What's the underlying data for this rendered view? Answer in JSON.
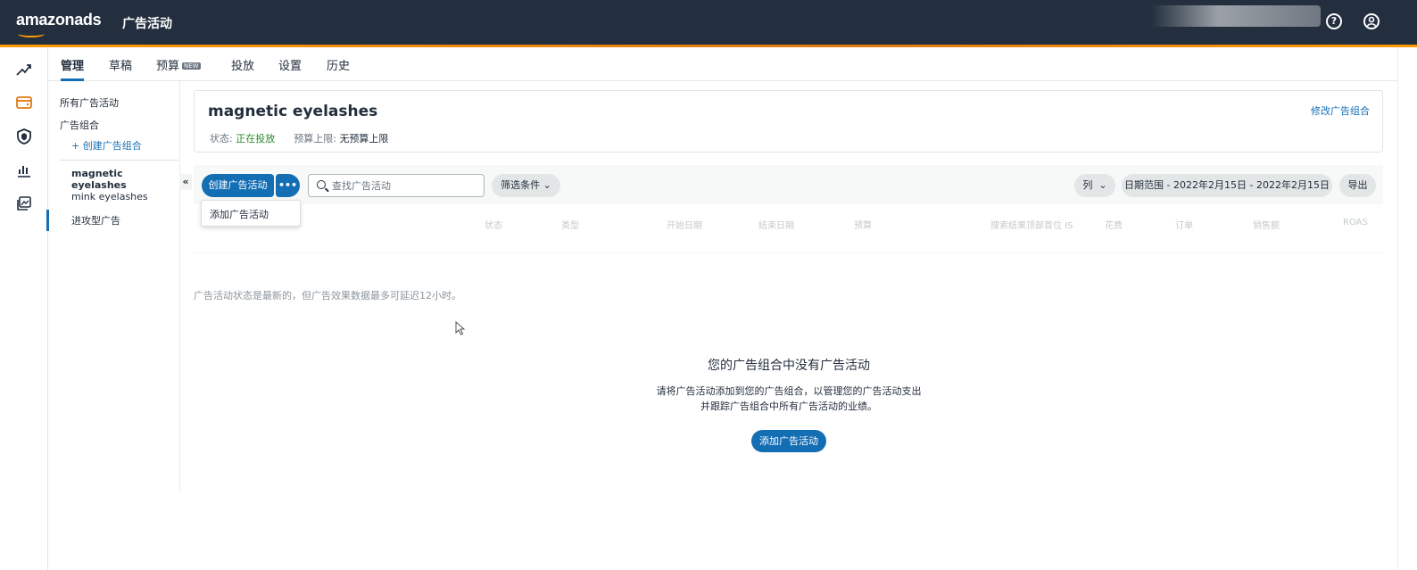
{
  "header": {
    "brand": "amazonads",
    "app_title": "广告活动",
    "help_icon": "question-circle-icon",
    "account_icon": "user-circle-icon"
  },
  "rail": {
    "icons": [
      "trend-chart-icon",
      "campaign-wallet-icon",
      "shield-icon",
      "bar-chart-icon",
      "media-library-icon"
    ]
  },
  "tabs": [
    {
      "label": "管理",
      "active": true
    },
    {
      "label": "草稿"
    },
    {
      "label": "预算",
      "badge": "NEW"
    },
    {
      "label": "投放"
    },
    {
      "label": "设置"
    },
    {
      "label": "历史"
    }
  ],
  "leftnav": {
    "all_campaigns": "所有广告活动",
    "portfolios": "广告组合",
    "create_portfolio": "+ 创建广告组合",
    "items": [
      "magnetic eyelashes",
      "mink eyelashes",
      "进攻型广告"
    ]
  },
  "portfolio": {
    "name": "magnetic eyelashes",
    "status_label": "状态:",
    "status_value": "正在投放",
    "budget_label": "预算上限:",
    "budget_value": "无预算上限",
    "edit_link": "修改广告组合"
  },
  "toolbar": {
    "create_campaign": "创建广告活动",
    "more": "•••",
    "search_placeholder": "查找广告活动",
    "filter": "筛选条件",
    "columns": "列",
    "date_range": "日期范围 - 2022年2月15日 - 2022年2月15日",
    "export": "导出"
  },
  "menu": {
    "add_campaign": "添加广告活动"
  },
  "table_headers": [
    "状态",
    "类型",
    "开始日期",
    "结束日期",
    "预算",
    "搜索结果顶部首位 IS",
    "花费",
    "订单",
    "销售额",
    "ROAS"
  ],
  "notice": "广告活动状态是最新的，但广告效果数据最多可延迟12小时。",
  "empty": {
    "title": "您的广告组合中没有广告活动",
    "desc_line1": "请将广告活动添加到您的广告组合，以管理您的广告活动支出",
    "desc_line2": "并跟踪广告组合中所有广告活动的业绩。",
    "cta": "添加广告活动"
  },
  "colors": {
    "topbar": "#232f3e",
    "accent": "#146eb4",
    "orange": "#ff9900",
    "status_green": "#2a8a2a"
  }
}
